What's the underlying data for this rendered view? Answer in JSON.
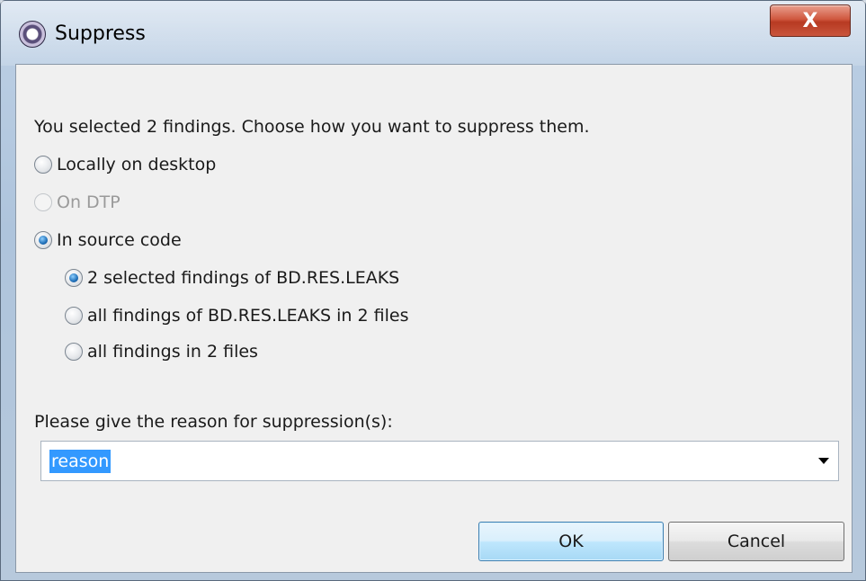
{
  "window": {
    "title": "Suppress",
    "close_label": "X"
  },
  "dialog": {
    "prompt": "You selected 2 findings. Choose how you want to suppress them.",
    "scope_options": [
      {
        "label": "Locally on desktop",
        "selected": false,
        "enabled": true
      },
      {
        "label": "On DTP",
        "selected": false,
        "enabled": false
      },
      {
        "label": "In source code",
        "selected": true,
        "enabled": true
      }
    ],
    "source_options": [
      {
        "label": "2 selected findings of BD.RES.LEAKS",
        "selected": true
      },
      {
        "label": "all findings of BD.RES.LEAKS in 2 files",
        "selected": false
      },
      {
        "label": "all findings in 2 files",
        "selected": false
      }
    ],
    "reason_label": "Please give the reason for suppression(s):",
    "reason_value": "reason"
  },
  "buttons": {
    "ok": "OK",
    "cancel": "Cancel"
  },
  "colors": {
    "selection_highlight": "#3399ff",
    "ok_button_border": "#3c7fb1",
    "close_button": "#c9553c"
  }
}
